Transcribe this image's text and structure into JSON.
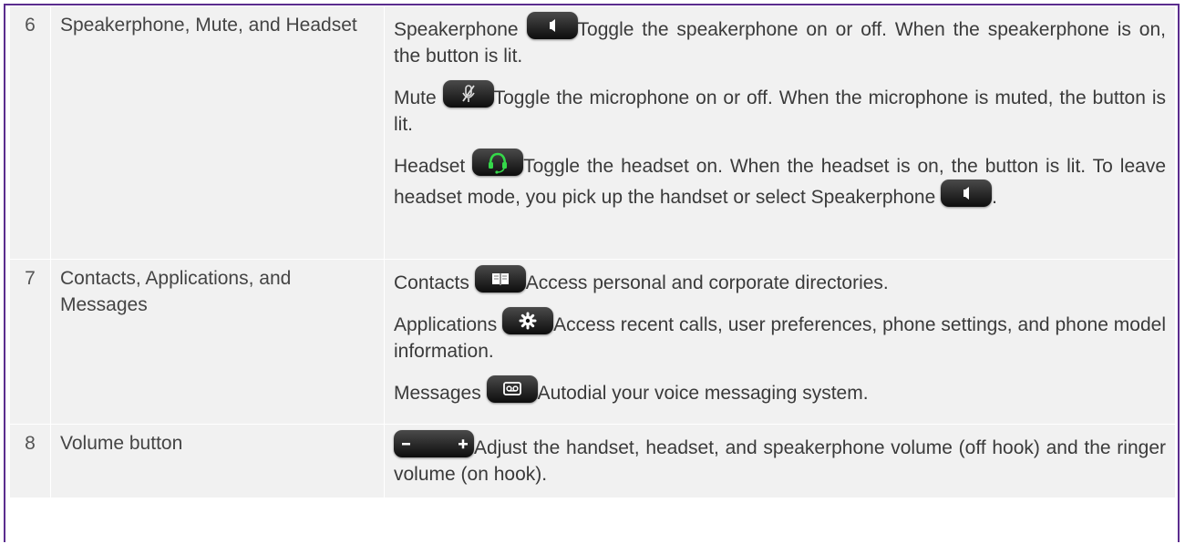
{
  "rows": [
    {
      "number": "6",
      "feature": "Speakerphone, Mute, and Headset",
      "items": [
        {
          "name": "Speakerphone",
          "icon": "speaker-icon",
          "text": "Toggle the speakerphone on or off. When the speakerphone is on, the button is lit."
        },
        {
          "name": "Mute",
          "icon": "mute-microphone-icon",
          "text": "Toggle the microphone on or off. When the microphone is muted, the button is lit."
        },
        {
          "name": "Headset",
          "icon": "headset-icon",
          "text": "Toggle the headset on. When the headset is on, the button is lit. To leave headset mode, you pick up the handset or select",
          "trailing_name": "Speakerphone",
          "trailing_icon": "speaker-icon",
          "trailing_punct": "."
        }
      ]
    },
    {
      "number": "7",
      "feature": "Contacts, Applications, and Messages",
      "items": [
        {
          "name": "Contacts",
          "icon": "book-icon",
          "text": "Access personal and corporate directories."
        },
        {
          "name": "Applications",
          "icon": "gear-icon",
          "text": "Access recent calls, user preferences, phone settings, and phone model information."
        },
        {
          "name": "Messages",
          "icon": "voicemail-icon",
          "text": "Autodial your voice messaging system."
        }
      ]
    },
    {
      "number": "8",
      "feature": "Volume button",
      "items": [
        {
          "name": "",
          "icon": "volume-rocker-icon",
          "text": "Adjust the handset, headset, and speakerphone volume (off hook) and the ringer volume (on hook)."
        }
      ]
    }
  ],
  "colors": {
    "frame_border": "#5b2d8e",
    "cell_background": "#f1f1f1",
    "headset_green": "#35d84a",
    "button_black": "#111111"
  }
}
